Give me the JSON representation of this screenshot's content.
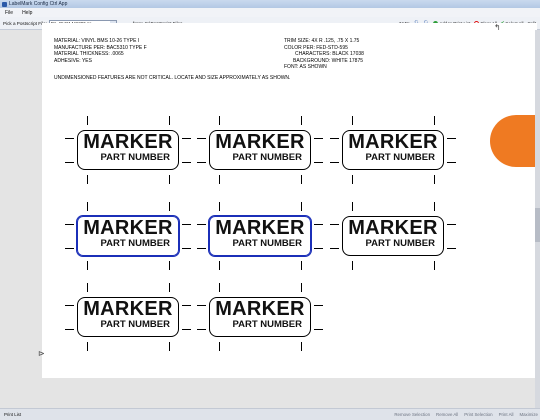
{
  "window": {
    "title": "LabelMark Config Ctrl App"
  },
  "menu": {
    "items": [
      "File",
      "Help"
    ]
  },
  "toolbar": {
    "pick_label": "Pick a Postscript File:",
    "file_value": "P1_65421446303.ps",
    "from_label": "from: C:\\PostScript Files",
    "zoom": "344%",
    "add_to_print_list": "Add to Print List",
    "clear_all": "Clear All",
    "select_all": "Select All",
    "split": "Split"
  },
  "spec": {
    "material": "MATERIAL:  VINYL BMS 10-26 TYPE I",
    "manufacture_per": "MANUFACTURE PER:   BAC5310 TYPE F",
    "material_thickness": "MATERIAL THICKNESS:    .0065",
    "adhesive": "ADHESIVE:   YES",
    "trim_size": "TRIM SIZE:  4X R .125,  .75 X 1.75",
    "color_per": "COLOR PER:   FED-STD-595",
    "characters": "CHARACTERS:   BLACK 17038",
    "background": "BACKGROUND:   WHITE 17875",
    "font": "FONT:  AS SHOWN",
    "note": "UNDIMENSIONED FEATURES ARE NOT CRITICAL. LOCATE AND SIZE APPROXIMATELY AS SHOWN."
  },
  "labels": [
    {
      "title": "MARKER",
      "subtitle": "PART NUMBER",
      "selected": false
    },
    {
      "title": "MARKER",
      "subtitle": "PART NUMBER",
      "selected": false
    },
    {
      "title": "MARKER",
      "subtitle": "PART NUMBER",
      "selected": false
    },
    {
      "title": "MARKER",
      "subtitle": "PART NUMBER",
      "selected": true
    },
    {
      "title": "MARKER",
      "subtitle": "PART NUMBER",
      "selected": true
    },
    {
      "title": "MARKER",
      "subtitle": "PART NUMBER",
      "selected": false
    },
    {
      "title": "MARKER",
      "subtitle": "PART NUMBER",
      "selected": false
    },
    {
      "title": "MARKER",
      "subtitle": "PART NUMBER",
      "selected": false
    }
  ],
  "status": {
    "print_list": "Print List",
    "remove_selection": "Remove Selection",
    "remove_all": "Remove All",
    "print_selection": "Print Selection",
    "print_all": "Print All",
    "maximize": "Maximize"
  },
  "colors": {
    "selection": "#1b2fb8",
    "accent_blob": "#ef7a22"
  }
}
